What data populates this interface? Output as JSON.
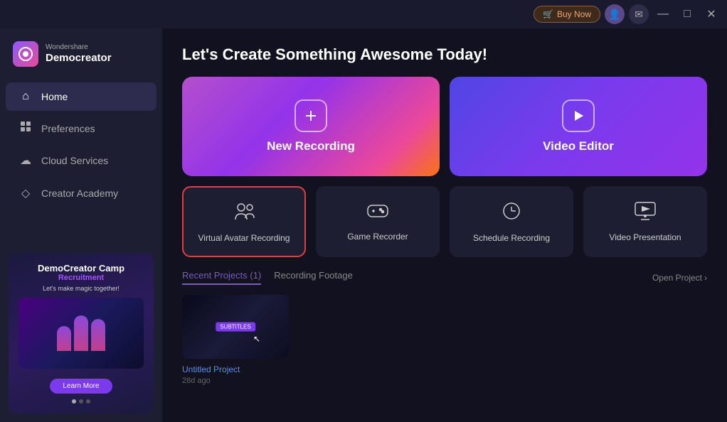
{
  "titlebar": {
    "buy_now_label": "Buy Now",
    "buy_icon": "🛒",
    "minimize_label": "—",
    "maximize_label": "□",
    "close_label": "✕"
  },
  "sidebar": {
    "logo": {
      "brand": "Wondershare",
      "name": "Democreator"
    },
    "nav_items": [
      {
        "id": "home",
        "label": "Home",
        "icon": "⌂",
        "active": true
      },
      {
        "id": "preferences",
        "label": "Preferences",
        "icon": "⊞",
        "active": false
      },
      {
        "id": "cloud-services",
        "label": "Cloud Services",
        "icon": "☁",
        "active": false
      },
      {
        "id": "creator-academy",
        "label": "Creator Academy",
        "icon": "◇",
        "active": false
      }
    ],
    "promo": {
      "title": "DemoCreator Camp",
      "subtitle": "Recruitment",
      "tagline": "Let's make magic together!",
      "learn_btn": "Learn More"
    }
  },
  "main": {
    "heading": "Let's Create Something Awesome Today!",
    "hero_cards": [
      {
        "id": "new-recording",
        "label": "New Recording",
        "icon": "+"
      },
      {
        "id": "video-editor",
        "label": "Video Editor",
        "icon": "▶"
      }
    ],
    "tool_cards": [
      {
        "id": "virtual-avatar",
        "label": "Virtual Avatar Recording",
        "icon": "👤",
        "selected": true
      },
      {
        "id": "game-recorder",
        "label": "Game Recorder",
        "icon": "🎮",
        "selected": false
      },
      {
        "id": "schedule-recording",
        "label": "Schedule Recording",
        "icon": "⏰",
        "selected": false
      },
      {
        "id": "video-presentation",
        "label": "Video Presentation",
        "icon": "🖥",
        "selected": false
      }
    ],
    "recent_tabs": [
      {
        "id": "recent-projects",
        "label": "Recent Projects (1)",
        "active": true
      },
      {
        "id": "recording-footage",
        "label": "Recording Footage",
        "active": false
      }
    ],
    "open_project": "Open Project",
    "projects": [
      {
        "id": "project-1",
        "name": "Untitled Project",
        "date": "28d ago",
        "thumb_label": "SUBTITLES"
      }
    ]
  }
}
